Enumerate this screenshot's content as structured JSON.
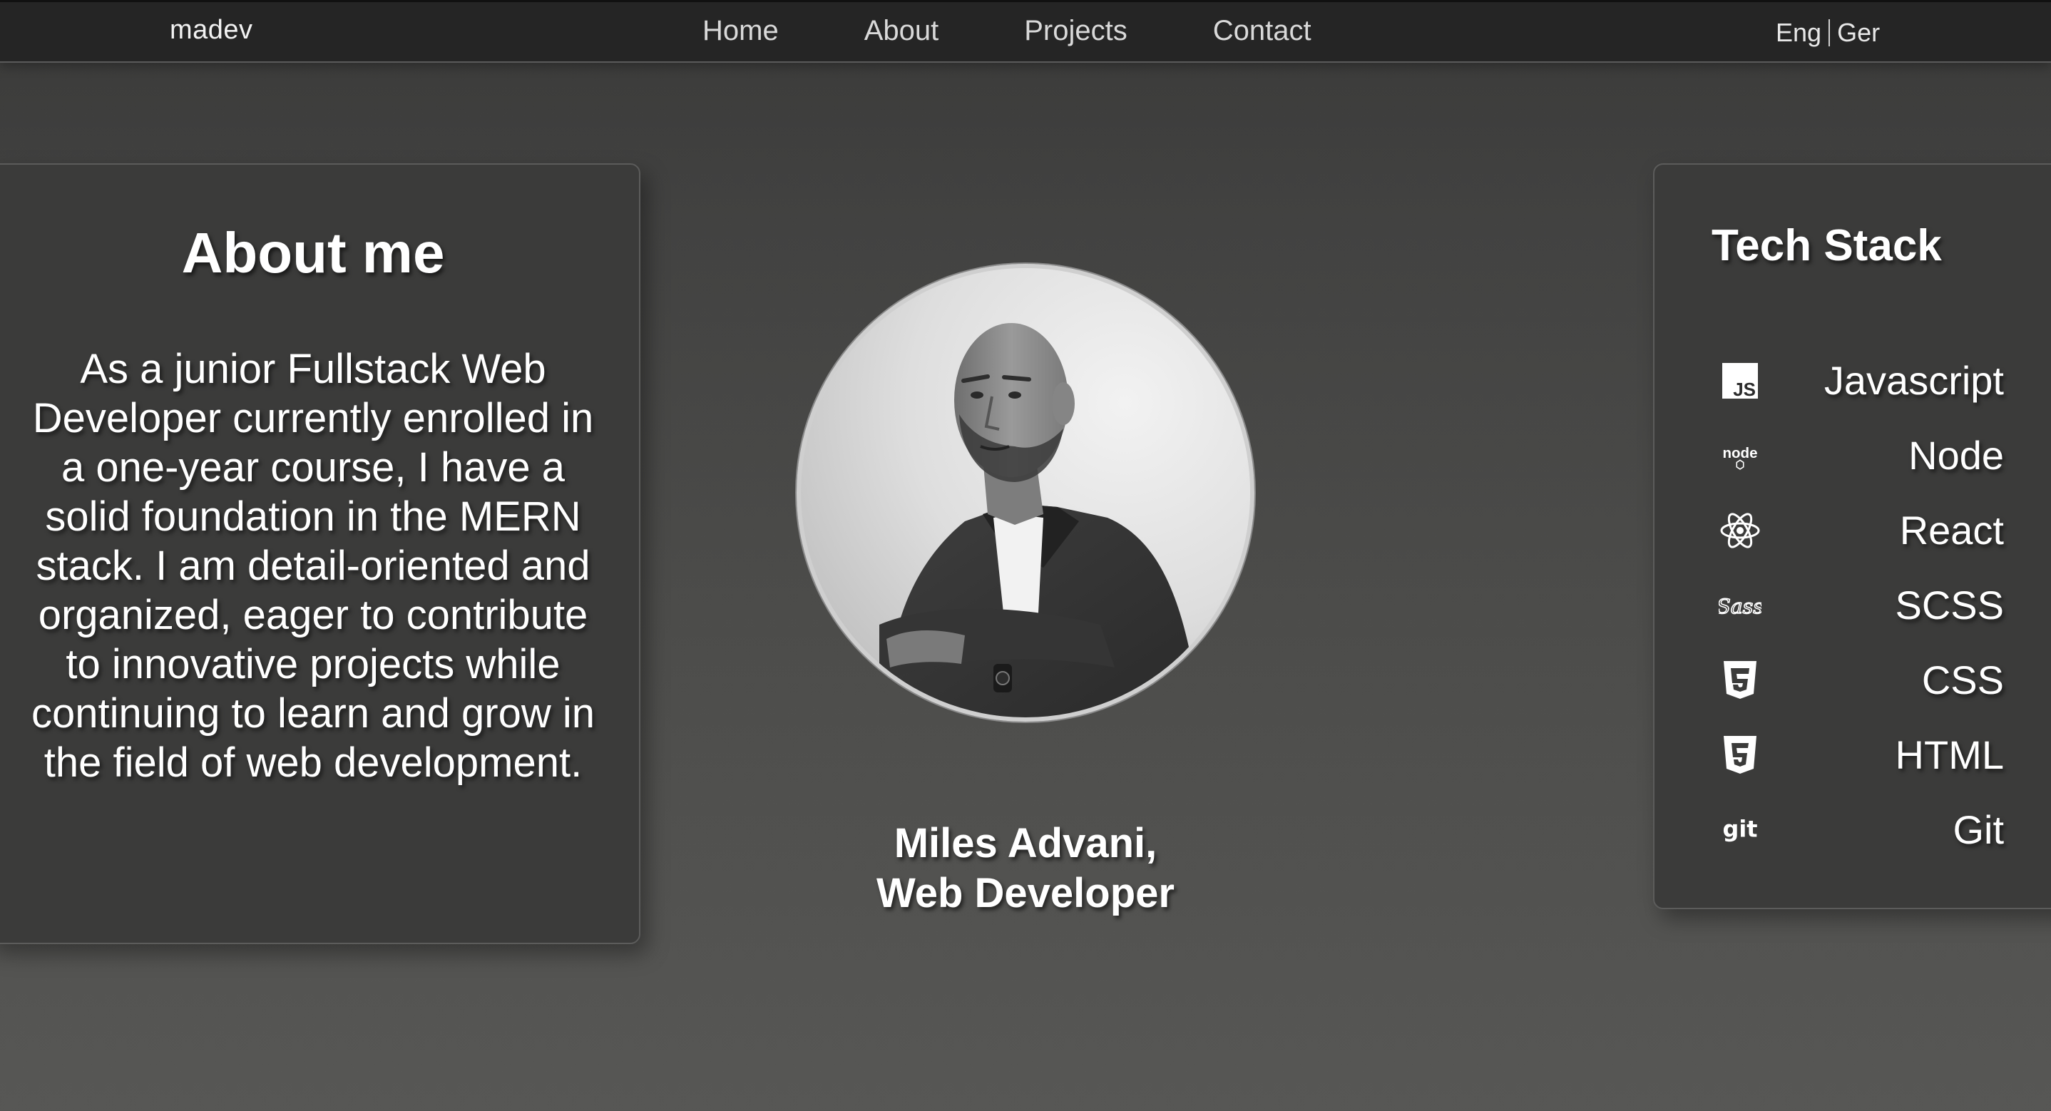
{
  "navbar": {
    "logo": "madev",
    "links": [
      {
        "label": "Home"
      },
      {
        "label": "About"
      },
      {
        "label": "Projects"
      },
      {
        "label": "Contact"
      }
    ],
    "languages": [
      "Eng",
      "Ger"
    ]
  },
  "about": {
    "title": "About me",
    "text": "As a junior Fullstack Web Developer currently enrolled in a one-year course, I have a solid foundation in the MERN stack. I am detail-oriented and organized, eager to contribute to innovative projects while continuing to learn and grow in the field of web development."
  },
  "profile": {
    "name": "Miles Advani,",
    "role": "Web Developer"
  },
  "tech_stack": {
    "title": "Tech Stack",
    "items": [
      {
        "label": "Javascript",
        "icon": "javascript-icon"
      },
      {
        "label": "Node",
        "icon": "node-icon"
      },
      {
        "label": "React",
        "icon": "react-icon"
      },
      {
        "label": "SCSS",
        "icon": "sass-icon"
      },
      {
        "label": "CSS",
        "icon": "css3-icon"
      },
      {
        "label": "HTML",
        "icon": "html5-icon"
      },
      {
        "label": "Git",
        "icon": "git-icon"
      }
    ]
  },
  "colors": {
    "navbar_bg": "#252525",
    "card_bg": "#3b3b3a",
    "text": "#ffffff"
  }
}
